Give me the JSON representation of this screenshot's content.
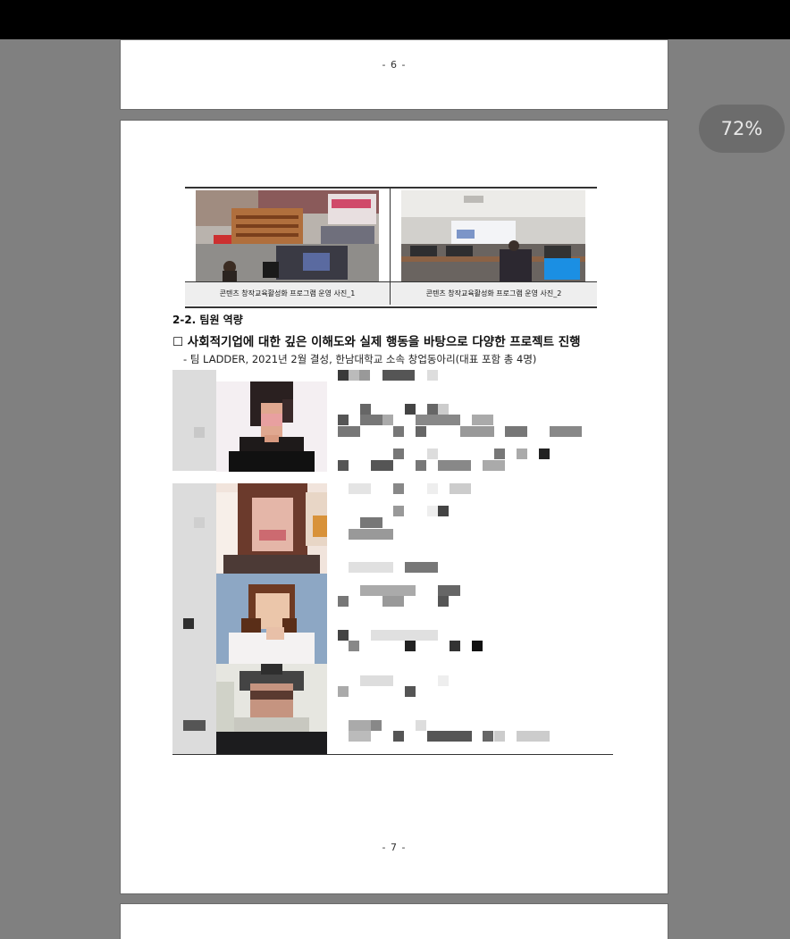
{
  "viewer": {
    "zoom_label": "72%"
  },
  "pages": {
    "prev_page_number": "- 6 -",
    "current_page_number": "- 7 -"
  },
  "photos": [
    {
      "caption": "콘텐츠 창작교육활성화 프로그램 운영 사진_1"
    },
    {
      "caption": "콘텐츠 창작교육활성화 프로그램 운영 사진_2"
    }
  ],
  "section": {
    "title": "2-2. 팀원 역량",
    "heading": "☐ 사회적기업에 대한 깊은 이해도와 실제 행동을 바탕으로 다양한 프로젝트 진행",
    "subtext": "- 팀 LADDER, 2021년 2월 결성, 한남대학교 소속 창업동아리(대표 포함 총 4명)"
  },
  "team_members": [
    {
      "role": "representative",
      "portrait": "blurred-portrait"
    },
    {
      "role": "member",
      "portrait": "blurred-portrait"
    },
    {
      "role": "member",
      "portrait": "blurred-portrait"
    },
    {
      "role": "member",
      "portrait": "blurred-portrait"
    }
  ],
  "colors": {
    "background": "#808080",
    "page": "#ffffff",
    "topbar": "#000000",
    "zoom_badge": "#6c6c6c"
  }
}
